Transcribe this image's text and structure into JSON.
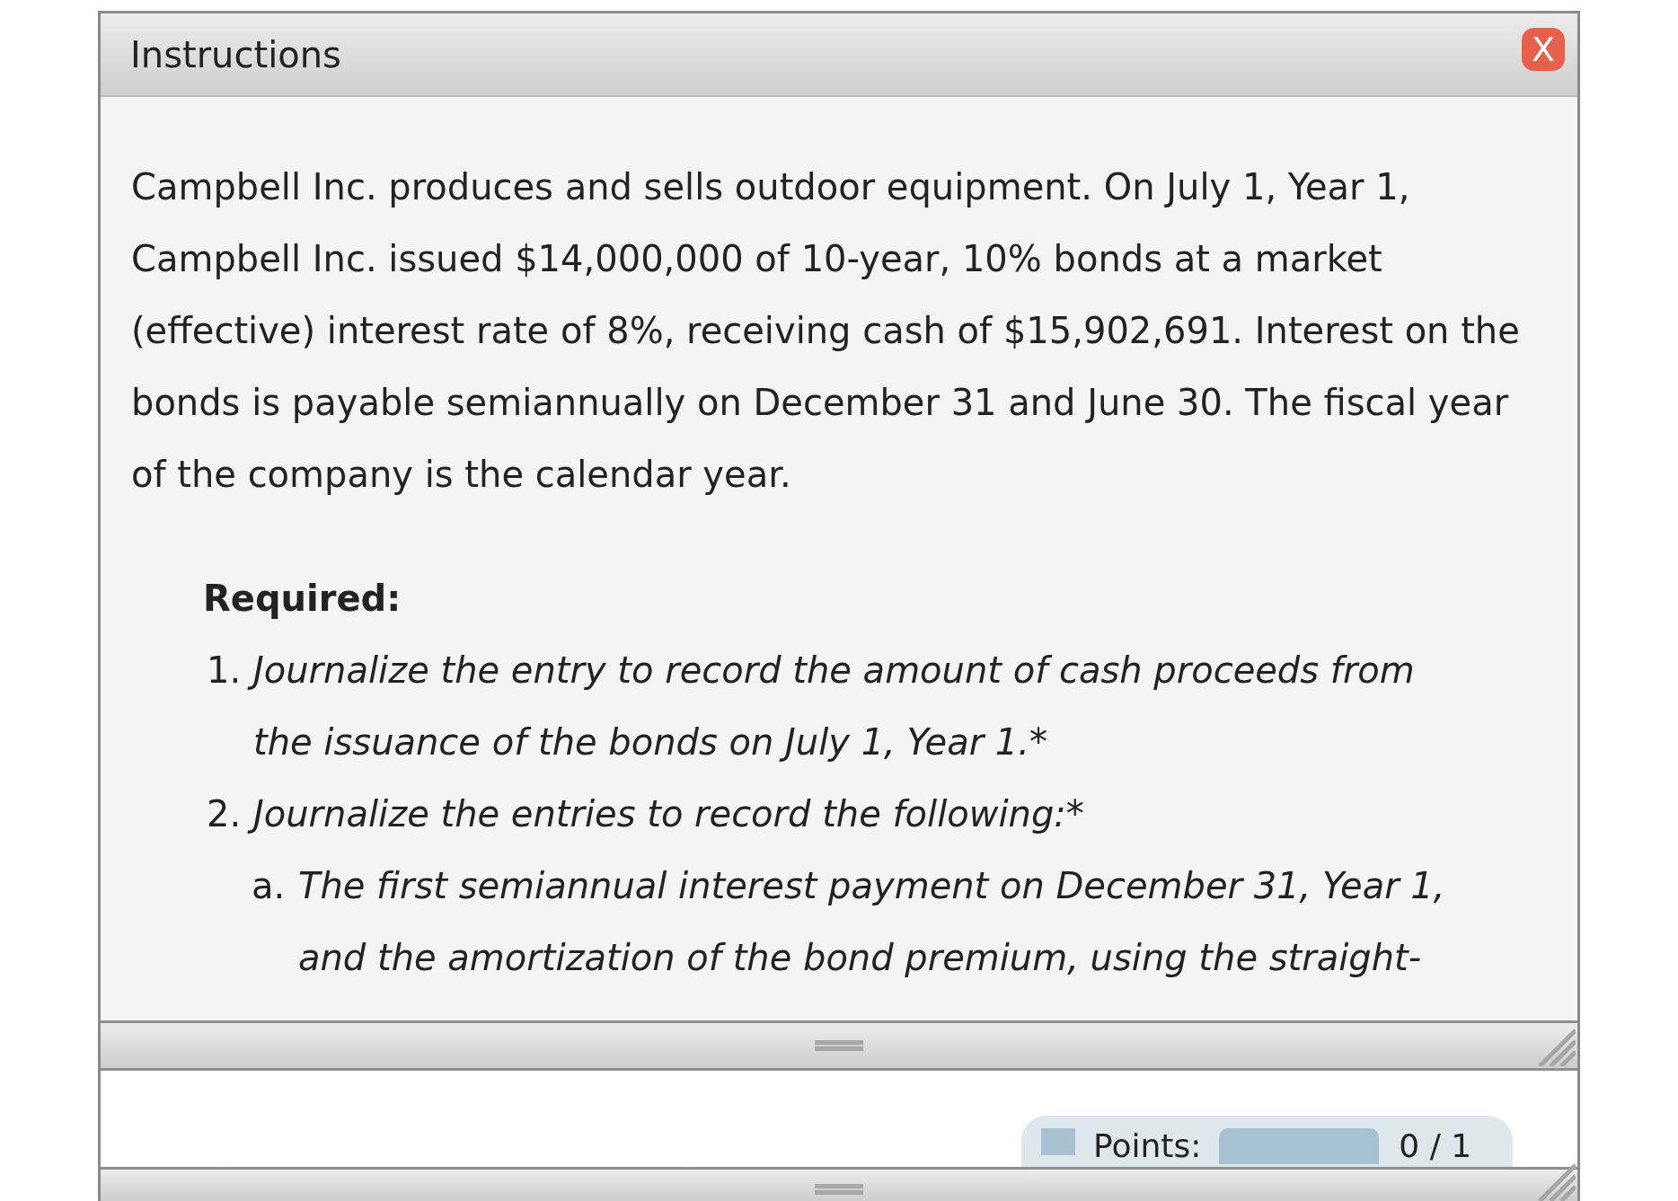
{
  "window": {
    "title": "Instructions",
    "close_label": "X"
  },
  "intro": {
    "lines": [
      "Campbell Inc. produces and sells outdoor equipment. On July 1, Year 1,",
      "Campbell Inc. issued $14,000,000 of 10-year, 10% bonds at a market",
      "(effective) interest rate of 8%, receiving cash of $15,902,691. Interest on the",
      "bonds is payable semiannually on December 31 and June 30. The fiscal year",
      "of the company is the calendar year."
    ]
  },
  "required": {
    "heading": "Required:",
    "items": [
      {
        "marker": "1.",
        "lines": [
          "Journalize the entry to record the amount of cash proceeds from",
          "the issuance of the bonds on July 1, Year 1.*"
        ]
      },
      {
        "marker": "2.",
        "lines": [
          "Journalize the entries to record the following:*"
        ],
        "children": [
          {
            "marker": "a.",
            "lines": [
              "The first semiannual interest payment on December 31, Year 1,",
              "and the amortization of the bond premium, using the straight-"
            ]
          }
        ]
      }
    ]
  },
  "points": {
    "label": "Points:",
    "score": "0 / 1"
  }
}
